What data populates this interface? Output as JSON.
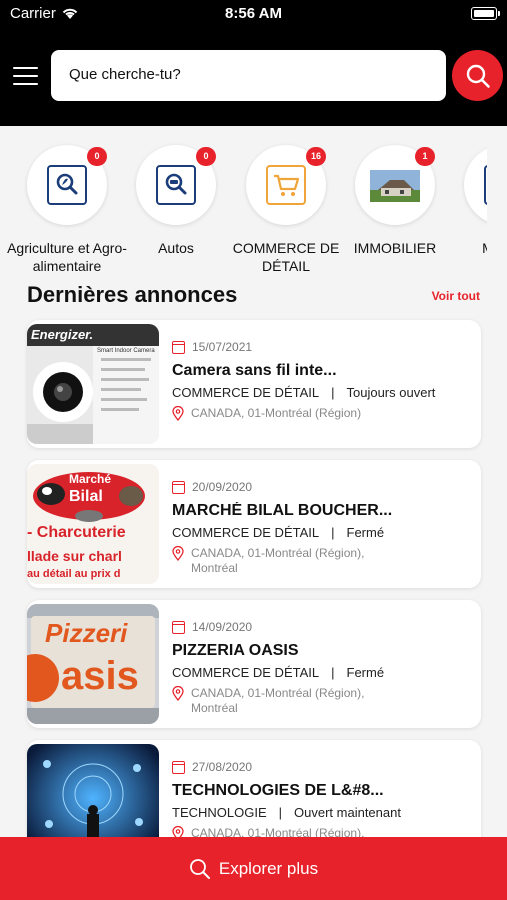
{
  "status_bar": {
    "carrier": "Carrier",
    "time": "8:56 AM"
  },
  "search": {
    "placeholder": "Que cherche-tu?"
  },
  "categories": [
    {
      "label": "Agriculture et Agro-alimentaire",
      "count": "0",
      "icon": "magnifier-leaf-icon"
    },
    {
      "label": "Autos",
      "count": "0",
      "icon": "magnifier-car-icon"
    },
    {
      "label": "COMMERCE DE DÉTAIL",
      "count": "16",
      "icon": "shopping-cart-icon"
    },
    {
      "label": "IMMOBILIER",
      "count": "1",
      "icon": "house-photo"
    },
    {
      "label": "M",
      "count": "",
      "icon": "partial-icon"
    }
  ],
  "section": {
    "title": "Dernières annonces",
    "see_all": "Voir tout"
  },
  "listings": [
    {
      "date": "15/07/2021",
      "title": "Camera sans fil inte...",
      "category": "COMMERCE DE DÉTAIL",
      "separator": "|",
      "status": "Toujours ouvert",
      "location": "CANADA, 01-Montréal (Région)"
    },
    {
      "date": "20/09/2020",
      "title": "MARCHÉ BILAL BOUCHER...",
      "category": "COMMERCE DE DÉTAIL",
      "separator": "|",
      "status": "Fermé",
      "location": "CANADA, 01-Montréal (Région),",
      "location2": "Montréal"
    },
    {
      "date": "14/09/2020",
      "title": "PIZZERIA OASIS",
      "category": "COMMERCE DE DÉTAIL",
      "separator": "|",
      "status": "Fermé",
      "location": "CANADA, 01-Montréal (Région),",
      "location2": "Montréal"
    },
    {
      "date": "27/08/2020",
      "title": "TECHNOLOGIES DE L&#8...",
      "category": "TECHNOLOGIE",
      "separator": "|",
      "status": "Ouvert maintenant",
      "location": "CANADA, 01-Montréal (Région),"
    }
  ],
  "thumbnails": {
    "energizer_brand": "Energizer.",
    "energizer_sub": "Smart Indoor Camera",
    "marche_line1": "Marché",
    "marche_line2": "Bilal",
    "marche_line3": "- Charcuterie",
    "marche_line4": "llade sur charl",
    "marche_line5": "au détail au prix d",
    "pizza_line1": "Pizzeri",
    "pizza_line2": "asis"
  },
  "footer": {
    "explore_label": "Explorer plus"
  },
  "colors": {
    "accent": "#e8222a",
    "header": "#000000",
    "icon_blue": "#1b3d7a",
    "icon_orange": "#f0a53a"
  }
}
